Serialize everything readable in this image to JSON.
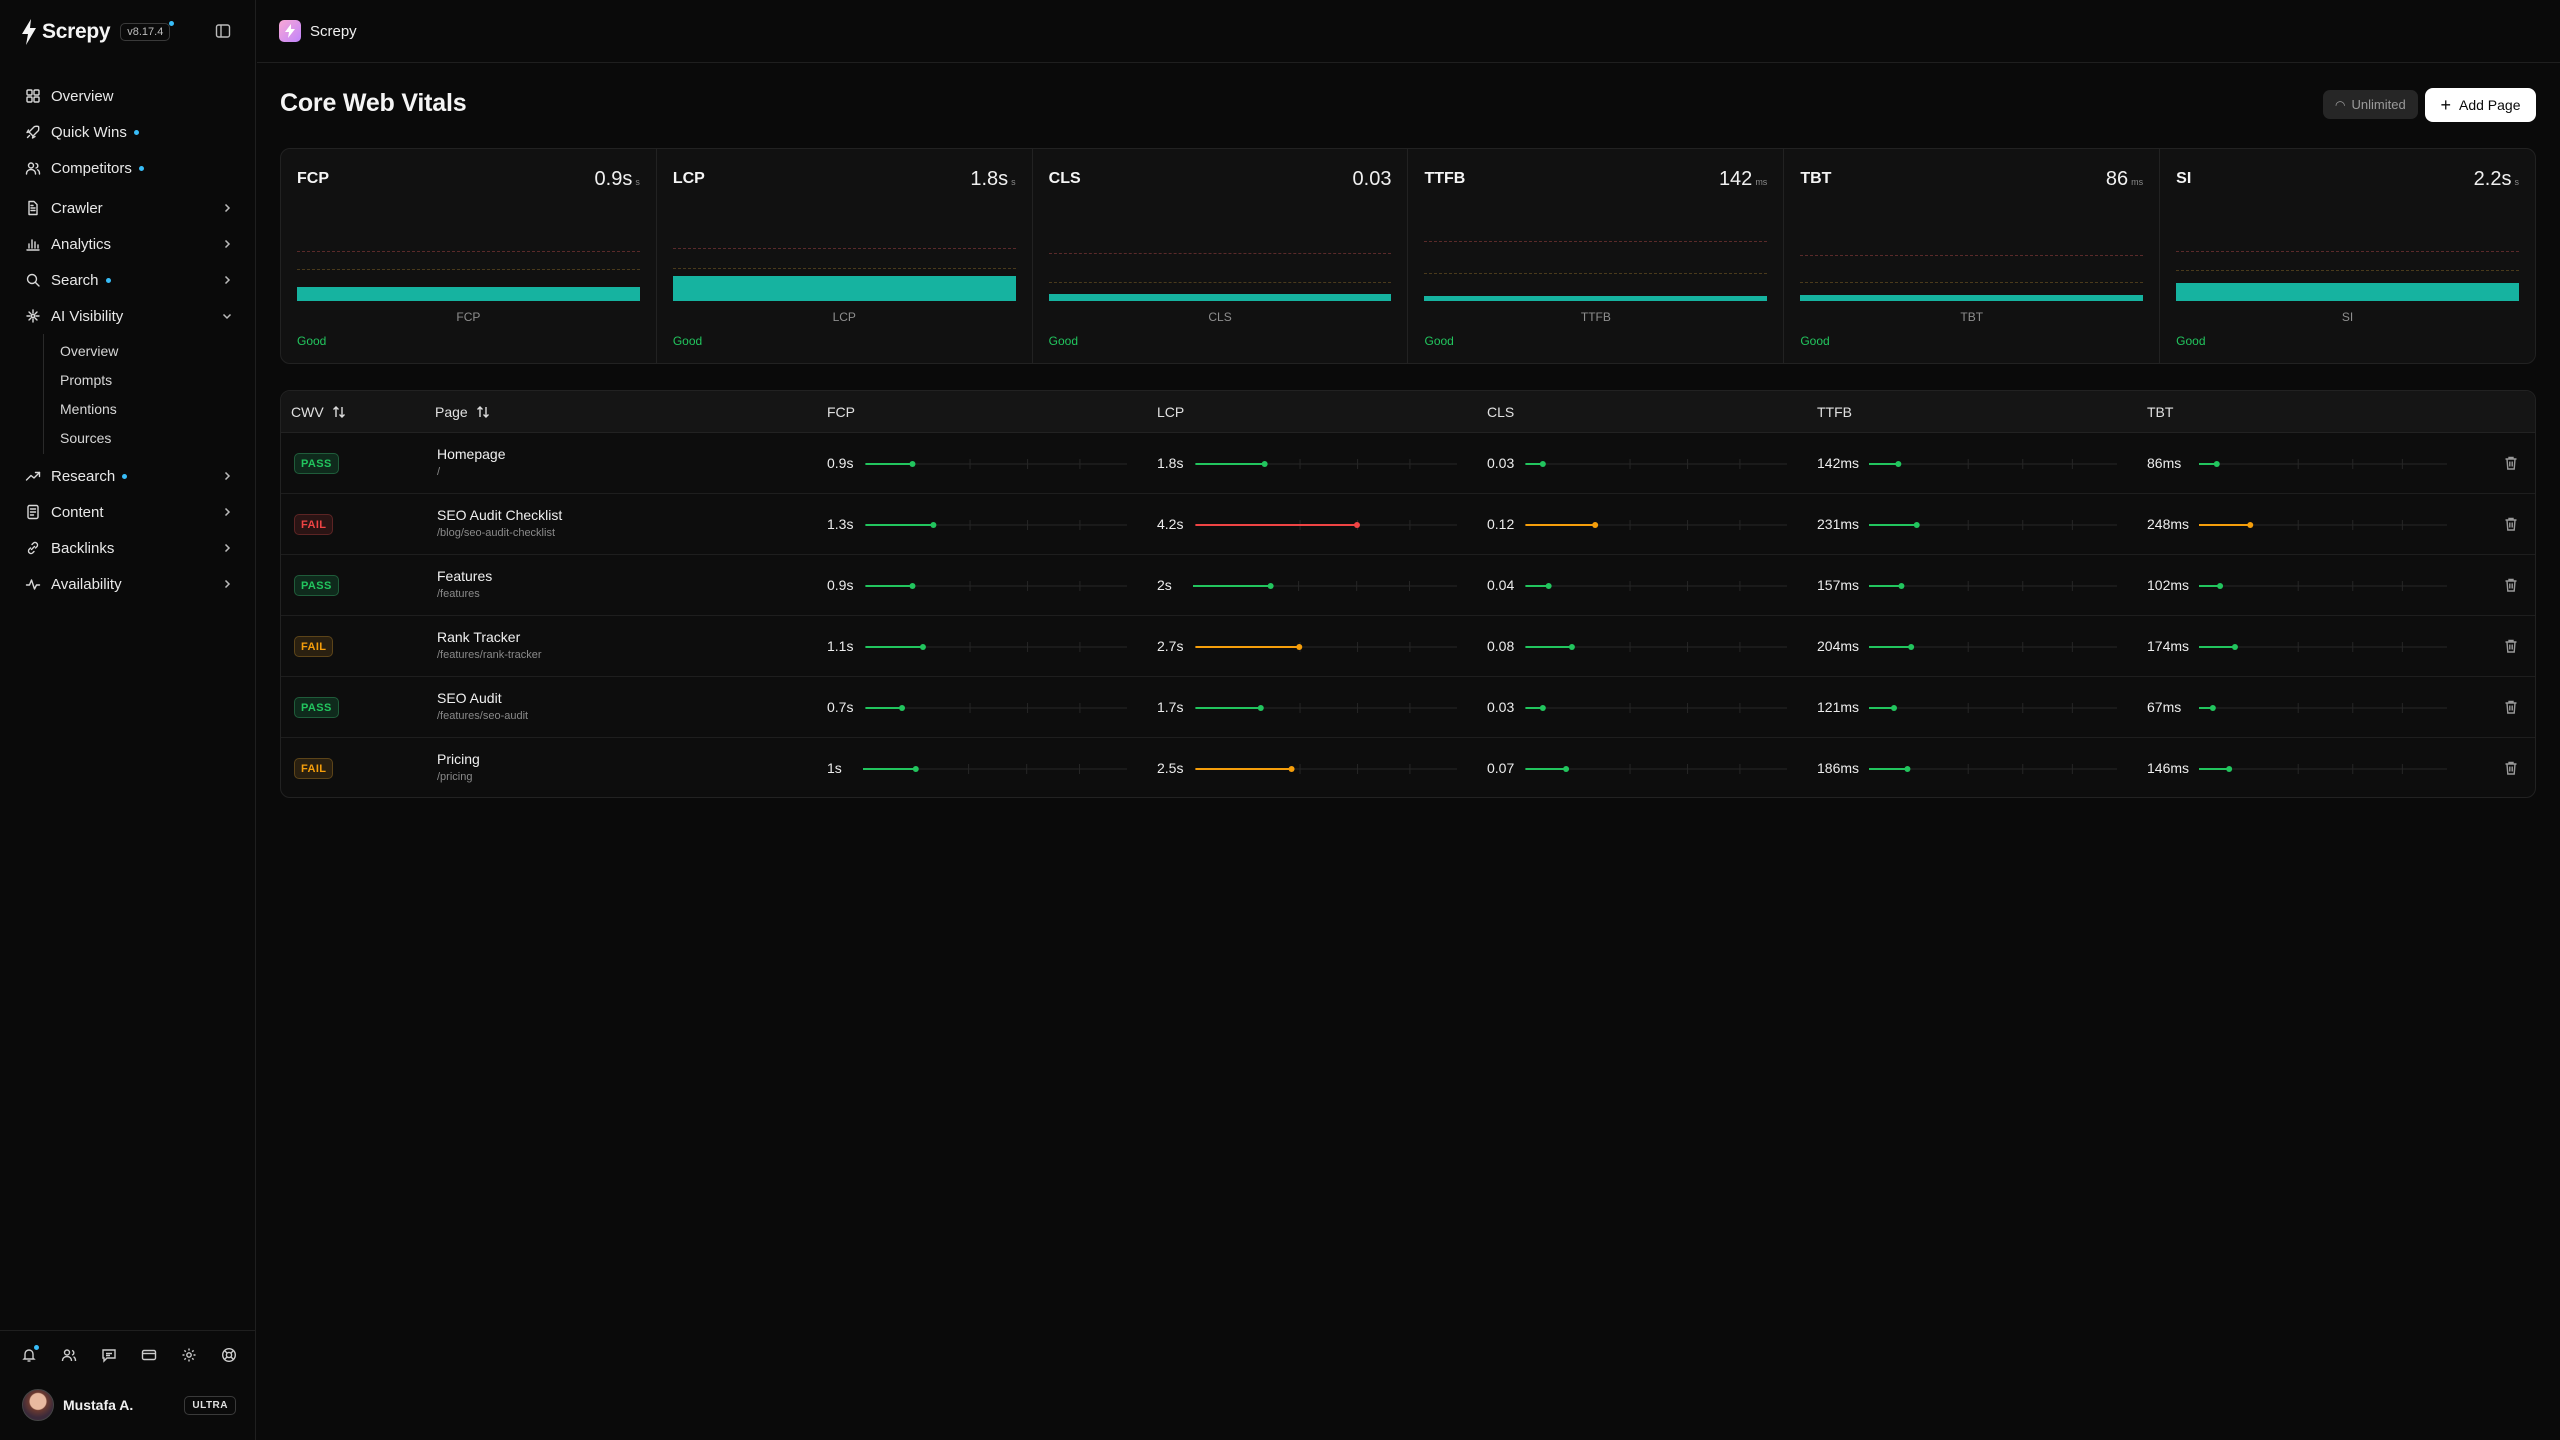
{
  "app": {
    "name": "Screpy",
    "version": "v8.17.4"
  },
  "nav": {
    "items": [
      {
        "label": "Overview",
        "icon": "grid-icon"
      },
      {
        "label": "Quick Wins",
        "icon": "rocket-icon",
        "dot": true
      },
      {
        "label": "Competitors",
        "icon": "users-icon",
        "dot": true
      },
      {
        "label": "Crawler",
        "icon": "file-icon",
        "chevron": "right"
      },
      {
        "label": "Analytics",
        "icon": "bar-chart-icon",
        "chevron": "right"
      },
      {
        "label": "Search",
        "icon": "search-icon",
        "dot": true,
        "chevron": "right"
      },
      {
        "label": "AI Visibility",
        "icon": "sparkle-icon",
        "chevron": "down"
      },
      {
        "label": "Research",
        "icon": "trend-icon",
        "dot": true,
        "chevron": "right"
      },
      {
        "label": "Content",
        "icon": "doc-icon",
        "chevron": "right"
      },
      {
        "label": "Backlinks",
        "icon": "link-icon",
        "chevron": "right"
      },
      {
        "label": "Availability",
        "icon": "pulse-icon",
        "chevron": "right"
      }
    ],
    "ai_visibility_sub": [
      "Overview",
      "Prompts",
      "Mentions",
      "Sources"
    ]
  },
  "user": {
    "name": "Mustafa A.",
    "plan": "ULTRA"
  },
  "workspace": {
    "name": "Screpy"
  },
  "page": {
    "title": "Core Web Vitals",
    "unlimited_label": "Unlimited",
    "add_label": "Add Page"
  },
  "metrics": [
    {
      "label": "FCP",
      "value": "0.9s",
      "unit": "s",
      "axis": "FCP",
      "status": "Good",
      "fill": 0.16,
      "thresholds": [
        0.55,
        0.34
      ]
    },
    {
      "label": "LCP",
      "value": "1.8s",
      "unit": "s",
      "axis": "LCP",
      "status": "Good",
      "fill": 0.28,
      "thresholds": [
        0.58,
        0.36
      ]
    },
    {
      "label": "CLS",
      "value": "0.03",
      "unit": "",
      "axis": "CLS",
      "status": "Good",
      "fill": 0.08,
      "thresholds": [
        0.52,
        0.2
      ]
    },
    {
      "label": "TTFB",
      "value": "142",
      "unit": "ms",
      "axis": "TTFB",
      "status": "Good",
      "fill": 0.06,
      "thresholds": [
        0.66,
        0.3
      ]
    },
    {
      "label": "TBT",
      "value": "86",
      "unit": "ms",
      "axis": "TBT",
      "status": "Good",
      "fill": 0.07,
      "thresholds": [
        0.5,
        0.2
      ]
    },
    {
      "label": "SI",
      "value": "2.2s",
      "unit": "s",
      "axis": "SI",
      "status": "Good",
      "fill": 0.2,
      "thresholds": [
        0.55,
        0.33
      ]
    }
  ],
  "table": {
    "headers": {
      "cwv": "CWV",
      "page": "Page",
      "fcp": "FCP",
      "lcp": "LCP",
      "cls": "CLS",
      "ttfb": "TTFB",
      "tbt": "TBT"
    },
    "rows": [
      {
        "status": "PASS",
        "badge": "pass",
        "title": "Homepage",
        "path": "/",
        "fcp": {
          "text": "0.9s",
          "val": 0.9,
          "color": "#22c55e"
        },
        "lcp": {
          "text": "1.8s",
          "val": 1.8,
          "color": "#22c55e"
        },
        "cls": {
          "text": "0.03",
          "val": 0.03,
          "color": "#22c55e"
        },
        "ttfb": {
          "text": "142ms",
          "val": 142,
          "color": "#22c55e"
        },
        "tbt": {
          "text": "86ms",
          "val": 86,
          "color": "#22c55e"
        }
      },
      {
        "status": "FAIL",
        "badge": "fail-red",
        "title": "SEO Audit Checklist",
        "path": "/blog/seo-audit-checklist",
        "fcp": {
          "text": "1.3s",
          "val": 1.3,
          "color": "#22c55e"
        },
        "lcp": {
          "text": "4.2s",
          "val": 4.2,
          "color": "#ef4444"
        },
        "cls": {
          "text": "0.12",
          "val": 0.12,
          "color": "#f59e0b"
        },
        "ttfb": {
          "text": "231ms",
          "val": 231,
          "color": "#22c55e"
        },
        "tbt": {
          "text": "248ms",
          "val": 248,
          "color": "#f59e0b"
        }
      },
      {
        "status": "PASS",
        "badge": "pass",
        "title": "Features",
        "path": "/features",
        "fcp": {
          "text": "0.9s",
          "val": 0.9,
          "color": "#22c55e"
        },
        "lcp": {
          "text": "2s",
          "val": 2.0,
          "color": "#22c55e"
        },
        "cls": {
          "text": "0.04",
          "val": 0.04,
          "color": "#22c55e"
        },
        "ttfb": {
          "text": "157ms",
          "val": 157,
          "color": "#22c55e"
        },
        "tbt": {
          "text": "102ms",
          "val": 102,
          "color": "#22c55e"
        }
      },
      {
        "status": "FAIL",
        "badge": "fail-amber",
        "title": "Rank Tracker",
        "path": "/features/rank-tracker",
        "fcp": {
          "text": "1.1s",
          "val": 1.1,
          "color": "#22c55e"
        },
        "lcp": {
          "text": "2.7s",
          "val": 2.7,
          "color": "#f59e0b"
        },
        "cls": {
          "text": "0.08",
          "val": 0.08,
          "color": "#22c55e"
        },
        "ttfb": {
          "text": "204ms",
          "val": 204,
          "color": "#22c55e"
        },
        "tbt": {
          "text": "174ms",
          "val": 174,
          "color": "#22c55e"
        }
      },
      {
        "status": "PASS",
        "badge": "pass",
        "title": "SEO Audit",
        "path": "/features/seo-audit",
        "fcp": {
          "text": "0.7s",
          "val": 0.7,
          "color": "#22c55e"
        },
        "lcp": {
          "text": "1.7s",
          "val": 1.7,
          "color": "#22c55e"
        },
        "cls": {
          "text": "0.03",
          "val": 0.03,
          "color": "#22c55e"
        },
        "ttfb": {
          "text": "121ms",
          "val": 121,
          "color": "#22c55e"
        },
        "tbt": {
          "text": "67ms",
          "val": 67,
          "color": "#22c55e"
        }
      },
      {
        "status": "FAIL",
        "badge": "fail-amber",
        "title": "Pricing",
        "path": "/pricing",
        "fcp": {
          "text": "1s",
          "val": 1.0,
          "color": "#22c55e"
        },
        "lcp": {
          "text": "2.5s",
          "val": 2.5,
          "color": "#f59e0b"
        },
        "cls": {
          "text": "0.07",
          "val": 0.07,
          "color": "#22c55e"
        },
        "ttfb": {
          "text": "186ms",
          "val": 186,
          "color": "#22c55e"
        },
        "tbt": {
          "text": "146ms",
          "val": 146,
          "color": "#22c55e"
        }
      }
    ]
  }
}
